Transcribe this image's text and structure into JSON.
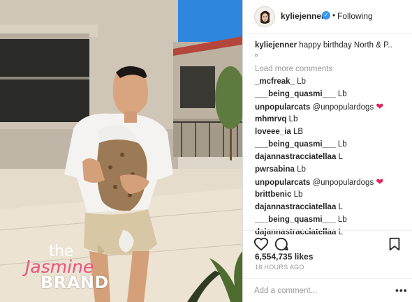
{
  "watermark": {
    "line1": "the",
    "line2": "Jasmine",
    "line3": "BRAND"
  },
  "header": {
    "username": "kyliejenner",
    "verified_mark": "✓",
    "separator": "•",
    "follow_status": "Following"
  },
  "caption": {
    "username": "kyliejenner",
    "text": "happy birthday North & P..",
    "emoji": "▫"
  },
  "load_more": "Load more comments",
  "comments": [
    {
      "user": "_mcfreak_",
      "text": "Lb",
      "heart": ""
    },
    {
      "user": "___being_quasmi___",
      "text": "Lb",
      "heart": ""
    },
    {
      "user": "unpopularcats",
      "text": "@unpopulardogs",
      "heart": "❤"
    },
    {
      "user": "mhmrvq",
      "text": "Lb",
      "heart": ""
    },
    {
      "user": "loveee_ia",
      "text": "LB",
      "heart": ""
    },
    {
      "user": "___being_quasmi___",
      "text": "Lb",
      "heart": ""
    },
    {
      "user": "dajannastracciatellaa",
      "text": "L",
      "heart": ""
    },
    {
      "user": "pwrsabina",
      "text": "Lb",
      "heart": ""
    },
    {
      "user": "unpopularcats",
      "text": "@unpopulardogs",
      "heart": "❤"
    },
    {
      "user": "brittbenic",
      "text": "Lb",
      "heart": ""
    },
    {
      "user": "dajannastracciatellaa",
      "text": "L",
      "heart": ""
    },
    {
      "user": "___being_quasmi___",
      "text": "Lb",
      "heart": ""
    },
    {
      "user": "dajannastracciatellaa",
      "text": "L",
      "heart": ""
    }
  ],
  "stats": {
    "likes": "6,554,735 likes",
    "time": "18 HOURS AGO"
  },
  "comment_box": {
    "placeholder": "Add a comment...",
    "more": "•••"
  },
  "colors": {
    "accent": "#3897f0",
    "heart": "#e0245e",
    "muted": "#999999",
    "watermark_pink": "#e8547c"
  },
  "icons": [
    "heart-icon",
    "comment-icon",
    "bookmark-icon",
    "verified-badge-icon",
    "more-options-icon"
  ]
}
